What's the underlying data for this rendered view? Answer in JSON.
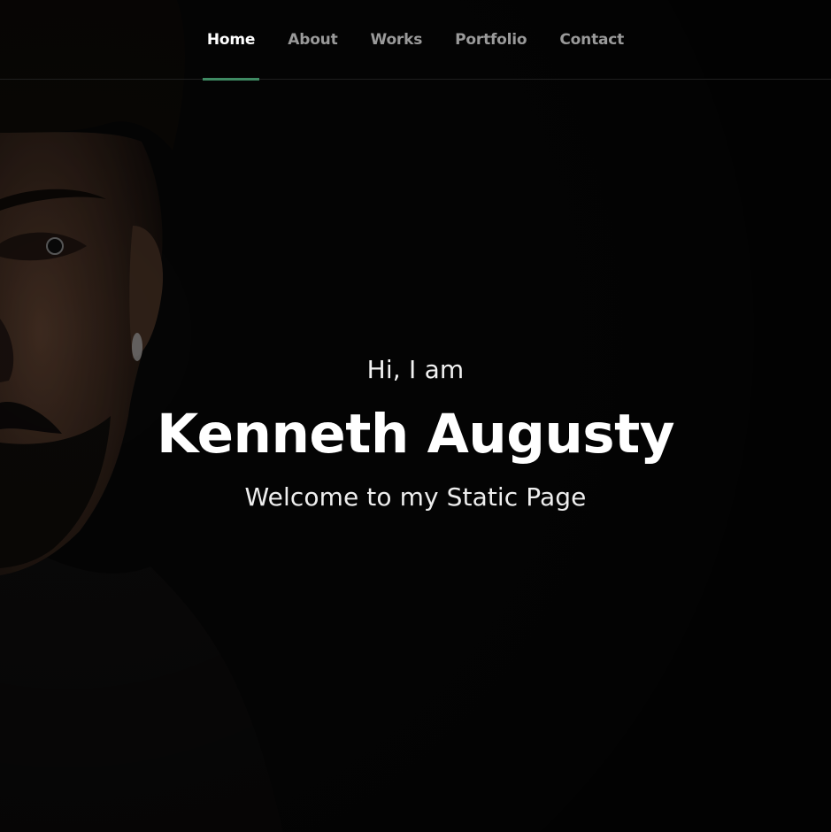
{
  "nav": {
    "items": [
      {
        "label": "Home",
        "active": true
      },
      {
        "label": "About",
        "active": false
      },
      {
        "label": "Works",
        "active": false
      },
      {
        "label": "Portfolio",
        "active": false
      },
      {
        "label": "Contact",
        "active": false
      }
    ]
  },
  "hero": {
    "greeting": "Hi, I am",
    "name": "Kenneth Augusty",
    "tagline": "Welcome to my Static Page"
  },
  "colors": {
    "background": "#060606",
    "nav_active_text": "#ffffff",
    "nav_inactive_text": "#9a9a9a",
    "nav_active_underline": "#3f8a63",
    "hero_text": "#ffffff"
  }
}
